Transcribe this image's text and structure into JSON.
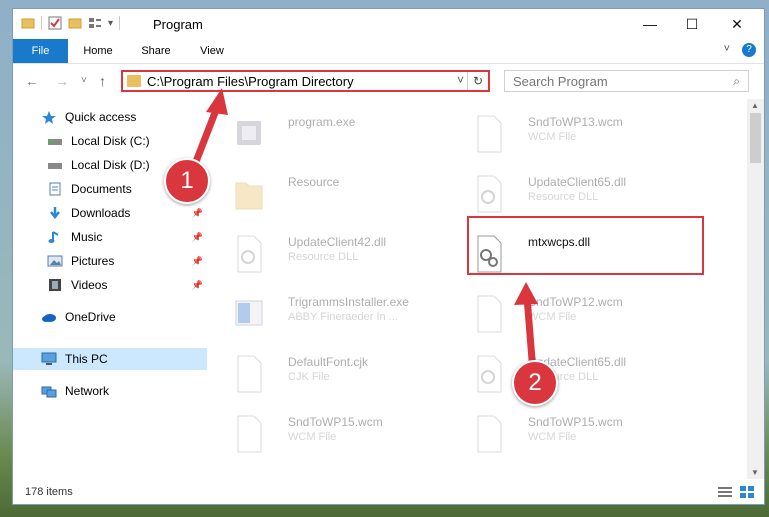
{
  "window": {
    "title": "Program",
    "controls": {
      "minimize": "—",
      "maximize": "☐",
      "close": "✕"
    }
  },
  "ribbon": {
    "tabs": [
      {
        "label": "File"
      },
      {
        "label": "Home"
      },
      {
        "label": "Share"
      },
      {
        "label": "View"
      }
    ],
    "expand_icon": "˅",
    "help_icon": "?"
  },
  "navigation": {
    "back": "←",
    "forward": "→",
    "recent": "˅",
    "up": "↑",
    "address": "C:\\Program Files\\Program Directory",
    "address_dropdown": "˅",
    "refresh": "↻",
    "search_placeholder": "Search Program",
    "search_icon": "⌕"
  },
  "sidebar": {
    "items": [
      {
        "label": "Quick access",
        "icon": "star-icon"
      },
      {
        "label": "Local Disk (C:)",
        "icon": "drive-icon"
      },
      {
        "label": "Local Disk (D:)",
        "icon": "drive-icon"
      },
      {
        "label": "Documents",
        "icon": "documents-icon"
      },
      {
        "label": "Downloads",
        "icon": "downloads-icon",
        "pin": "📌"
      },
      {
        "label": "Music",
        "icon": "music-icon",
        "pin": "📌"
      },
      {
        "label": "Pictures",
        "icon": "pictures-icon",
        "pin": "📌"
      },
      {
        "label": "Videos",
        "icon": "videos-icon",
        "pin": "📌"
      },
      {
        "label": "OneDrive",
        "icon": "cloud-icon"
      },
      {
        "label": "This PC",
        "icon": "computer-icon",
        "selected": true
      },
      {
        "label": "Network",
        "icon": "network-icon"
      }
    ]
  },
  "files": [
    {
      "name": "program.exe",
      "type": ""
    },
    {
      "name": "SndToWP13.wcm",
      "type": "WCM File"
    },
    {
      "name": "Resource",
      "type": ""
    },
    {
      "name": "UpdateClient65.dll",
      "type": "Resource DLL"
    },
    {
      "name": "UpdateClient42.dll",
      "type": "Resource DLL"
    },
    {
      "name": "mtxwcps.dll",
      "type": "",
      "highlighted": true
    },
    {
      "name": "TrigrammsInstaller.exe",
      "type": "ABBY Fineraeder In ..."
    },
    {
      "name": "SndToWP12.wcm",
      "type": "WCM File"
    },
    {
      "name": "DefaultFont.cjk",
      "type": "CJK File"
    },
    {
      "name": "UpdateClient65.dll",
      "type": "Resource DLL"
    },
    {
      "name": "SndToWP15.wcm",
      "type": "WCM File"
    },
    {
      "name": "SndToWP15.wcm",
      "type": "WCM File"
    }
  ],
  "status": {
    "item_count": "178 items"
  },
  "callouts": [
    "1",
    "2"
  ],
  "colors": {
    "accent": "#1979ca",
    "highlight_red": "#d9363e",
    "selected_bg": "#cce8ff"
  }
}
